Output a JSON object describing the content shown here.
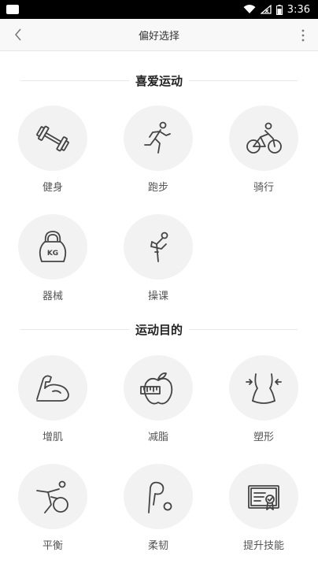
{
  "status": {
    "time": "3:36"
  },
  "header": {
    "title": "偏好选择"
  },
  "sections": [
    {
      "title": "喜爱运动",
      "items": [
        {
          "label": "健身",
          "icon": "dumbbell-icon"
        },
        {
          "label": "跑步",
          "icon": "runner-icon"
        },
        {
          "label": "骑行",
          "icon": "cyclist-icon"
        },
        {
          "label": "器械",
          "icon": "kettlebell-icon",
          "icon_text": "KG"
        },
        {
          "label": "操课",
          "icon": "stretch-icon"
        }
      ]
    },
    {
      "title": "运动目的",
      "items": [
        {
          "label": "增肌",
          "icon": "bicep-icon"
        },
        {
          "label": "减脂",
          "icon": "apple-tape-icon"
        },
        {
          "label": "塑形",
          "icon": "waist-icon"
        },
        {
          "label": "平衡",
          "icon": "balance-ball-icon"
        },
        {
          "label": "柔韧",
          "icon": "flexibility-icon"
        },
        {
          "label": "提升技能",
          "icon": "certificate-icon"
        }
      ]
    }
  ]
}
